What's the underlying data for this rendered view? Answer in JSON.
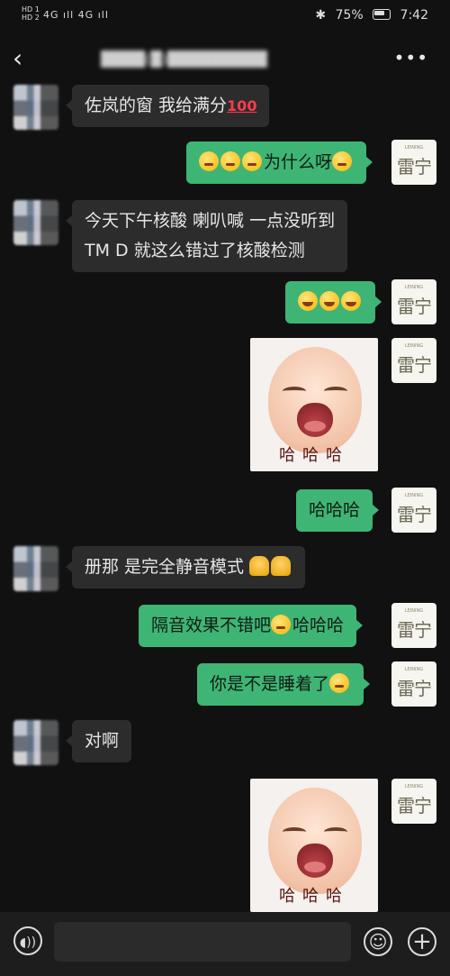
{
  "status_bar": {
    "hd1": "HD 1",
    "hd2": "HD 2",
    "signal": "4G ıll 4G ıll",
    "battery_percent": "75%",
    "time": "7:42"
  },
  "header": {
    "back_icon": "chevron-left-icon",
    "title": "████(█)█████████",
    "more_label": "•••"
  },
  "messages": [
    {
      "side": "left",
      "text": "佐岚的窗 我给满分",
      "suffix": "💯"
    },
    {
      "side": "right",
      "text": "为什么呀",
      "emoji_before": 3,
      "emoji_after": 1
    },
    {
      "side": "left",
      "line1": "今天下午核酸 喇叭喊 一点没听到",
      "line2": "TM D  就这么错过了核酸检测"
    },
    {
      "side": "right",
      "emoji_only": 3
    },
    {
      "side": "right",
      "sticker_text": "哈哈哈"
    },
    {
      "side": "right",
      "text": "哈哈哈"
    },
    {
      "side": "left",
      "text": "册那 是完全静音模式 "
    },
    {
      "side": "right",
      "text_a": "隔音效果不错吧",
      "text_b": "哈哈哈"
    },
    {
      "side": "right",
      "text": "你是不是睡着了"
    },
    {
      "side": "left",
      "text": "对啊"
    },
    {
      "side": "right",
      "sticker_text": "哈哈哈"
    }
  ],
  "right_avatar": {
    "brand": "雷宁",
    "tiny": "LEINING"
  },
  "bottom_bar": {
    "voice_icon": "voice-icon",
    "emoji_icon": "emoji-icon",
    "plus_icon": "plus-icon"
  }
}
